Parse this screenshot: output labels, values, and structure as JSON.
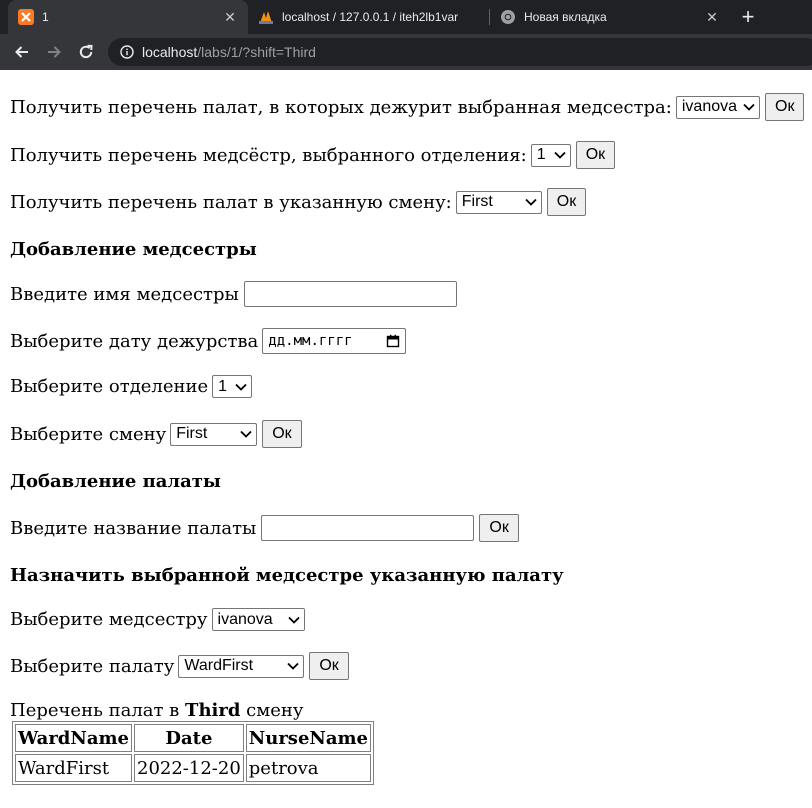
{
  "browser": {
    "tabs": [
      {
        "title": "1",
        "icon": "xampp-icon",
        "active": true
      },
      {
        "title": "localhost / 127.0.0.1 / iteh2lb1var",
        "icon": "phpmyadmin-icon",
        "active": false
      },
      {
        "title": "Новая вкладка",
        "icon": "chrome-icon",
        "active": false
      }
    ],
    "close_glyph": "✕",
    "new_tab_glyph": "+",
    "url_host": "localhost",
    "url_path": "/labs/1/?shift=Third"
  },
  "forms": {
    "nurse_wards": {
      "label": "Получить перечень палат, в которых дежурит выбранная медсестра:",
      "select_value": "ivanova",
      "button": "Ок"
    },
    "dept_nurses": {
      "label": "Получить перечень медсёстр, выбранного отделения:",
      "select_value": "1",
      "button": "Ок"
    },
    "shift_wards": {
      "label": "Получить перечень палат в указанную смену:",
      "select_value": "First",
      "button": "Ок"
    }
  },
  "add_nurse": {
    "heading": "Добавление медсестры",
    "name_label": "Введите имя медсестры",
    "name_value": "",
    "date_label": "Выберите дату дежурства",
    "date_placeholder": "дд.мм.гггг",
    "dept_label": "Выберите отделение",
    "dept_value": "1",
    "shift_label": "Выберите смену",
    "shift_value": "First",
    "button": "Ок"
  },
  "add_ward": {
    "heading": "Добавление палаты",
    "name_label": "Введите название палаты",
    "name_value": "",
    "button": "Ок"
  },
  "assign": {
    "heading": "Назначить выбранной медсестре указанную палату",
    "nurse_label": "Выберите медсестру",
    "nurse_value": "ivanova",
    "ward_label": "Выберите палату",
    "ward_value": "WardFirst",
    "button": "Ок"
  },
  "result": {
    "caption_prefix": "Перечень палат в",
    "caption_shift": "Third",
    "caption_suffix": "смену",
    "columns": [
      "WardName",
      "Date",
      "NurseName"
    ],
    "rows": [
      [
        "WardFirst",
        "2022-12-20",
        "petrova"
      ]
    ]
  }
}
